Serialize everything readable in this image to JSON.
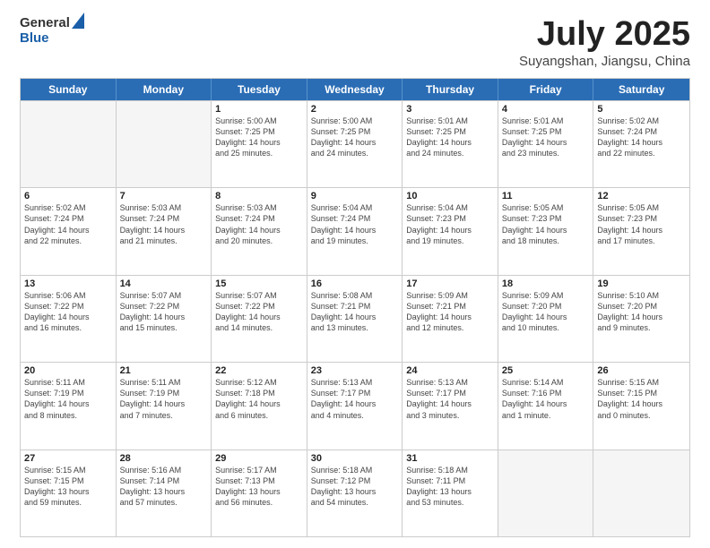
{
  "header": {
    "logo_general": "General",
    "logo_blue": "Blue",
    "title": "July 2025",
    "location": "Suyangshan, Jiangsu, China"
  },
  "days_of_week": [
    "Sunday",
    "Monday",
    "Tuesday",
    "Wednesday",
    "Thursday",
    "Friday",
    "Saturday"
  ],
  "weeks": [
    [
      {
        "day": "",
        "lines": []
      },
      {
        "day": "",
        "lines": []
      },
      {
        "day": "1",
        "lines": [
          "Sunrise: 5:00 AM",
          "Sunset: 7:25 PM",
          "Daylight: 14 hours",
          "and 25 minutes."
        ]
      },
      {
        "day": "2",
        "lines": [
          "Sunrise: 5:00 AM",
          "Sunset: 7:25 PM",
          "Daylight: 14 hours",
          "and 24 minutes."
        ]
      },
      {
        "day": "3",
        "lines": [
          "Sunrise: 5:01 AM",
          "Sunset: 7:25 PM",
          "Daylight: 14 hours",
          "and 24 minutes."
        ]
      },
      {
        "day": "4",
        "lines": [
          "Sunrise: 5:01 AM",
          "Sunset: 7:25 PM",
          "Daylight: 14 hours",
          "and 23 minutes."
        ]
      },
      {
        "day": "5",
        "lines": [
          "Sunrise: 5:02 AM",
          "Sunset: 7:24 PM",
          "Daylight: 14 hours",
          "and 22 minutes."
        ]
      }
    ],
    [
      {
        "day": "6",
        "lines": [
          "Sunrise: 5:02 AM",
          "Sunset: 7:24 PM",
          "Daylight: 14 hours",
          "and 22 minutes."
        ]
      },
      {
        "day": "7",
        "lines": [
          "Sunrise: 5:03 AM",
          "Sunset: 7:24 PM",
          "Daylight: 14 hours",
          "and 21 minutes."
        ]
      },
      {
        "day": "8",
        "lines": [
          "Sunrise: 5:03 AM",
          "Sunset: 7:24 PM",
          "Daylight: 14 hours",
          "and 20 minutes."
        ]
      },
      {
        "day": "9",
        "lines": [
          "Sunrise: 5:04 AM",
          "Sunset: 7:24 PM",
          "Daylight: 14 hours",
          "and 19 minutes."
        ]
      },
      {
        "day": "10",
        "lines": [
          "Sunrise: 5:04 AM",
          "Sunset: 7:23 PM",
          "Daylight: 14 hours",
          "and 19 minutes."
        ]
      },
      {
        "day": "11",
        "lines": [
          "Sunrise: 5:05 AM",
          "Sunset: 7:23 PM",
          "Daylight: 14 hours",
          "and 18 minutes."
        ]
      },
      {
        "day": "12",
        "lines": [
          "Sunrise: 5:05 AM",
          "Sunset: 7:23 PM",
          "Daylight: 14 hours",
          "and 17 minutes."
        ]
      }
    ],
    [
      {
        "day": "13",
        "lines": [
          "Sunrise: 5:06 AM",
          "Sunset: 7:22 PM",
          "Daylight: 14 hours",
          "and 16 minutes."
        ]
      },
      {
        "day": "14",
        "lines": [
          "Sunrise: 5:07 AM",
          "Sunset: 7:22 PM",
          "Daylight: 14 hours",
          "and 15 minutes."
        ]
      },
      {
        "day": "15",
        "lines": [
          "Sunrise: 5:07 AM",
          "Sunset: 7:22 PM",
          "Daylight: 14 hours",
          "and 14 minutes."
        ]
      },
      {
        "day": "16",
        "lines": [
          "Sunrise: 5:08 AM",
          "Sunset: 7:21 PM",
          "Daylight: 14 hours",
          "and 13 minutes."
        ]
      },
      {
        "day": "17",
        "lines": [
          "Sunrise: 5:09 AM",
          "Sunset: 7:21 PM",
          "Daylight: 14 hours",
          "and 12 minutes."
        ]
      },
      {
        "day": "18",
        "lines": [
          "Sunrise: 5:09 AM",
          "Sunset: 7:20 PM",
          "Daylight: 14 hours",
          "and 10 minutes."
        ]
      },
      {
        "day": "19",
        "lines": [
          "Sunrise: 5:10 AM",
          "Sunset: 7:20 PM",
          "Daylight: 14 hours",
          "and 9 minutes."
        ]
      }
    ],
    [
      {
        "day": "20",
        "lines": [
          "Sunrise: 5:11 AM",
          "Sunset: 7:19 PM",
          "Daylight: 14 hours",
          "and 8 minutes."
        ]
      },
      {
        "day": "21",
        "lines": [
          "Sunrise: 5:11 AM",
          "Sunset: 7:19 PM",
          "Daylight: 14 hours",
          "and 7 minutes."
        ]
      },
      {
        "day": "22",
        "lines": [
          "Sunrise: 5:12 AM",
          "Sunset: 7:18 PM",
          "Daylight: 14 hours",
          "and 6 minutes."
        ]
      },
      {
        "day": "23",
        "lines": [
          "Sunrise: 5:13 AM",
          "Sunset: 7:17 PM",
          "Daylight: 14 hours",
          "and 4 minutes."
        ]
      },
      {
        "day": "24",
        "lines": [
          "Sunrise: 5:13 AM",
          "Sunset: 7:17 PM",
          "Daylight: 14 hours",
          "and 3 minutes."
        ]
      },
      {
        "day": "25",
        "lines": [
          "Sunrise: 5:14 AM",
          "Sunset: 7:16 PM",
          "Daylight: 14 hours",
          "and 1 minute."
        ]
      },
      {
        "day": "26",
        "lines": [
          "Sunrise: 5:15 AM",
          "Sunset: 7:15 PM",
          "Daylight: 14 hours",
          "and 0 minutes."
        ]
      }
    ],
    [
      {
        "day": "27",
        "lines": [
          "Sunrise: 5:15 AM",
          "Sunset: 7:15 PM",
          "Daylight: 13 hours",
          "and 59 minutes."
        ]
      },
      {
        "day": "28",
        "lines": [
          "Sunrise: 5:16 AM",
          "Sunset: 7:14 PM",
          "Daylight: 13 hours",
          "and 57 minutes."
        ]
      },
      {
        "day": "29",
        "lines": [
          "Sunrise: 5:17 AM",
          "Sunset: 7:13 PM",
          "Daylight: 13 hours",
          "and 56 minutes."
        ]
      },
      {
        "day": "30",
        "lines": [
          "Sunrise: 5:18 AM",
          "Sunset: 7:12 PM",
          "Daylight: 13 hours",
          "and 54 minutes."
        ]
      },
      {
        "day": "31",
        "lines": [
          "Sunrise: 5:18 AM",
          "Sunset: 7:11 PM",
          "Daylight: 13 hours",
          "and 53 minutes."
        ]
      },
      {
        "day": "",
        "lines": []
      },
      {
        "day": "",
        "lines": []
      }
    ]
  ]
}
